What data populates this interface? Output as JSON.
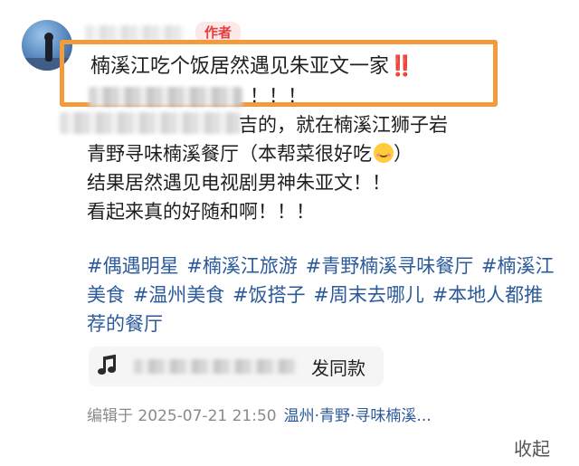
{
  "post": {
    "author_badge": "作者",
    "title": "楠溪江吃个饭居然遇见朱亚文一家",
    "title_emphasis": "‼️",
    "body_line2_tail": "！！！",
    "body_line3_tail": "吉的，就在楠溪江狮子岩",
    "body_line4": "青野寻味楠溪餐厅（本帮菜很好吃",
    "body_line4_end": "）",
    "body_line5": "结果居然遇见电视剧男神朱亚文！！",
    "body_line6": "看起来真的好随和啊！！！",
    "emoji_name": "smiling-face-icon"
  },
  "tags": [
    "#偶遇明星",
    "#楠溪江旅游",
    "#青野楠溪寻味餐厅",
    "#楠溪江美食",
    "#温州美食",
    "#饭搭子",
    "#周末去哪儿",
    "#本地人都推荐的餐厅"
  ],
  "music": {
    "icon": "music-note-icon",
    "action_label": "发同款"
  },
  "meta": {
    "edited_label": "编辑于 2025-07-21 21:50",
    "location": "温州·青野·寻味楠溪..."
  },
  "collapse_label": "收起",
  "colors": {
    "highlight_border": "#f39a3d",
    "tag_link": "#2b5a9b",
    "badge_text": "#e53c3c",
    "badge_bg": "#fde8e8"
  }
}
